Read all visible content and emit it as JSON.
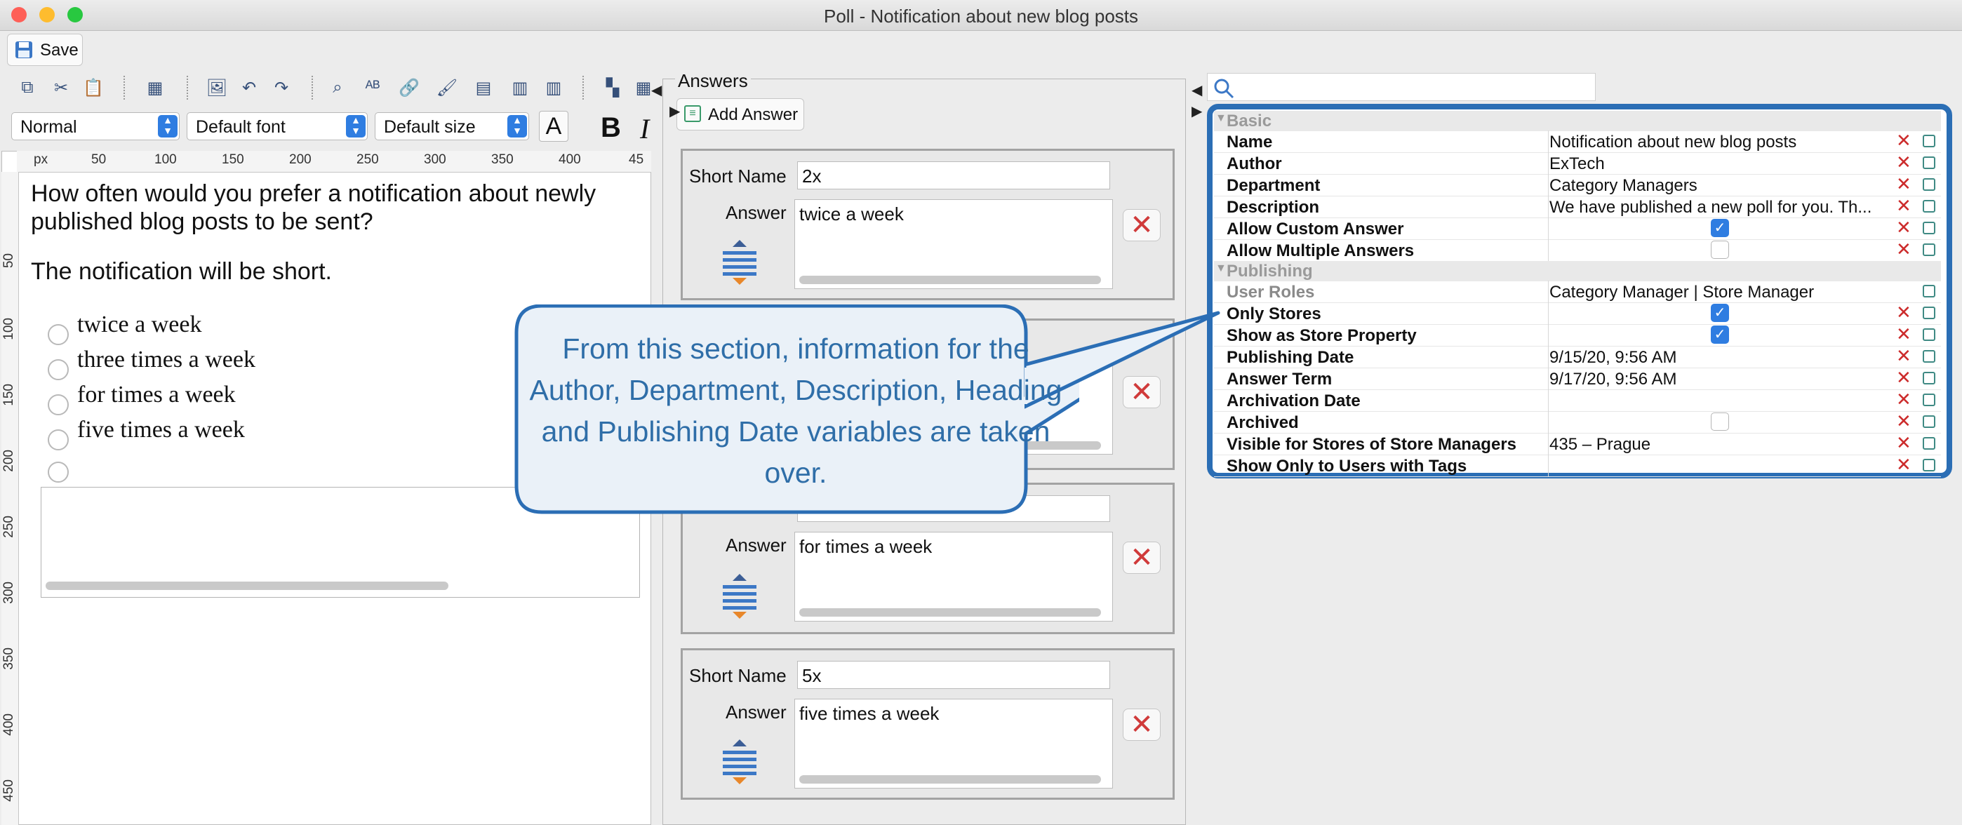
{
  "window": {
    "title": "Poll - Notification about new blog posts"
  },
  "toolbar": {
    "save_label": "Save",
    "style_value": "Normal",
    "font_value": "Default font",
    "size_value": "Default size",
    "text_color_glyph": "A",
    "bold_glyph": "B",
    "italic_glyph": "I"
  },
  "ruler": {
    "unit": "px",
    "h_ticks": [
      "50",
      "100",
      "150",
      "200",
      "250",
      "300",
      "350",
      "400",
      "45"
    ],
    "v_ticks": [
      "50",
      "100",
      "150",
      "200",
      "250",
      "300",
      "350",
      "400",
      "450"
    ]
  },
  "editor": {
    "question": "How often would you prefer a notification about newly published blog posts to be sent?",
    "note": "The notification will be short.",
    "options": [
      "twice a week",
      "three times a week",
      "for times a week",
      "five times a week"
    ]
  },
  "answers": {
    "panel_title": "Answers",
    "add_button": "Add Answer",
    "short_name_label": "Short Name",
    "answer_label": "Answer",
    "cards": [
      {
        "short_name": "2x",
        "answer": "twice a week"
      },
      {
        "short_name": "",
        "answer": ""
      },
      {
        "short_name": "",
        "answer": "for times a week"
      },
      {
        "short_name": "5x",
        "answer": "five times a week"
      }
    ]
  },
  "properties": {
    "search_placeholder": "",
    "groups": {
      "basic": "Basic",
      "publishing": "Publishing"
    },
    "rows": [
      {
        "name": "Name",
        "value": "Notification about new blog posts"
      },
      {
        "name": "Author",
        "value": "ExTech"
      },
      {
        "name": "Department",
        "value": "Category Managers"
      },
      {
        "name": "Description",
        "value": "We have published a new poll for you. Th..."
      },
      {
        "name": "Allow Custom Answer",
        "value": "",
        "checked": true
      },
      {
        "name": "Allow Multiple Answers",
        "value": "",
        "checked": false
      },
      {
        "name": "User Roles",
        "value": "Category Manager | Store Manager"
      },
      {
        "name": "Only Stores",
        "value": "",
        "checked": true
      },
      {
        "name": "Show as Store Property",
        "value": "",
        "checked": true
      },
      {
        "name": "Publishing Date",
        "value": "9/15/20, 9:56 AM"
      },
      {
        "name": "Answer Term",
        "value": "9/17/20, 9:56 AM"
      },
      {
        "name": "Archivation Date",
        "value": ""
      },
      {
        "name": "Archived",
        "value": "",
        "checked": false
      },
      {
        "name": "Visible for Stores of Store Managers",
        "value": "435 – Prague"
      },
      {
        "name": "Show Only to Users with Tags",
        "value": ""
      }
    ]
  },
  "callout": {
    "text": "From this section, information for the Author, Department, Description, Heading and Publishing Date variables are taken over."
  },
  "colors": {
    "accent": "#2b6eb5",
    "callout_fill": "#eaf1f8",
    "callout_text": "#2f6ea8",
    "delete_red": "#d03a3a",
    "checkbox_blue": "#2f7de1"
  }
}
